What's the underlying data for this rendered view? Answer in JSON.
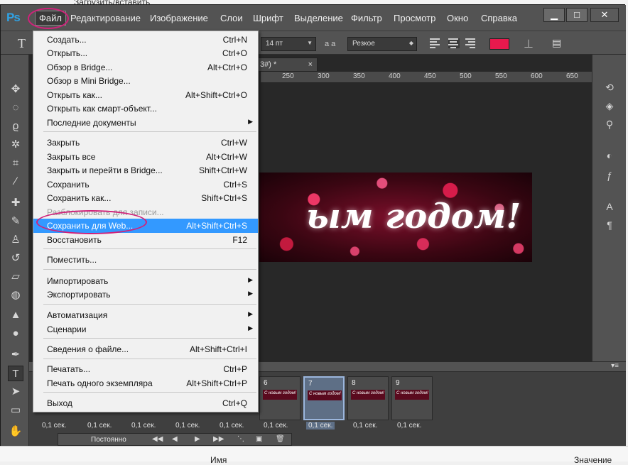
{
  "outer": {
    "top_text": "Загрузить/вставить",
    "bottom_name": "Имя",
    "bottom_value": "Значение"
  },
  "app": {
    "logo": "Ps",
    "menu": [
      "Файл",
      "Редактирование",
      "Изображение",
      "Слои",
      "Шрифт",
      "Выделение",
      "Фильтр",
      "Просмотр",
      "Окно",
      "Справка"
    ],
    "window_buttons": [
      "▁",
      "□",
      "✕"
    ]
  },
  "options": {
    "tool_letter": "T",
    "font_size": "14 пт",
    "aa_label": "a a",
    "antialias": "Резкое",
    "text_color": "#e8194d"
  },
  "document": {
    "tab": "3#) *",
    "ruler_ticks": [
      "250",
      "300",
      "350",
      "400",
      "450",
      "500",
      "550",
      "600",
      "650"
    ],
    "banner_text": "ым годом!"
  },
  "file_menu": {
    "items": [
      {
        "label": "Создать...",
        "shortcut": "Ctrl+N"
      },
      {
        "label": "Открыть...",
        "shortcut": "Ctrl+O"
      },
      {
        "label": "Обзор в Bridge...",
        "shortcut": "Alt+Ctrl+O"
      },
      {
        "label": "Обзор в Mini Bridge...",
        "shortcut": ""
      },
      {
        "label": "Открыть как...",
        "shortcut": "Alt+Shift+Ctrl+O"
      },
      {
        "label": "Открыть как смарт-объект...",
        "shortcut": ""
      },
      {
        "label": "Последние документы",
        "shortcut": "",
        "submenu": true
      },
      {
        "label": "Закрыть",
        "shortcut": "Ctrl+W"
      },
      {
        "label": "Закрыть все",
        "shortcut": "Alt+Ctrl+W"
      },
      {
        "label": "Закрыть и перейти в Bridge...",
        "shortcut": "Shift+Ctrl+W"
      },
      {
        "label": "Сохранить",
        "shortcut": "Ctrl+S"
      },
      {
        "label": "Сохранить как...",
        "shortcut": "Shift+Ctrl+S"
      },
      {
        "label": "Разблокировать для записи...",
        "shortcut": "",
        "disabled": true
      },
      {
        "label": "Сохранить для Web...",
        "shortcut": "Alt+Shift+Ctrl+S",
        "highlighted": true
      },
      {
        "label": "Восстановить",
        "shortcut": "F12"
      },
      {
        "label": "Поместить...",
        "shortcut": ""
      },
      {
        "label": "Импортировать",
        "shortcut": "",
        "submenu": true
      },
      {
        "label": "Экспортировать",
        "shortcut": "",
        "submenu": true
      },
      {
        "label": "Автоматизация",
        "shortcut": "",
        "submenu": true
      },
      {
        "label": "Сценарии",
        "shortcut": "",
        "submenu": true
      },
      {
        "label": "Сведения о файле...",
        "shortcut": "Alt+Shift+Ctrl+I"
      },
      {
        "label": "Печатать...",
        "shortcut": "Ctrl+P"
      },
      {
        "label": "Печать одного экземпляра",
        "shortcut": "Alt+Shift+Ctrl+P"
      },
      {
        "label": "Выход",
        "shortcut": "Ctrl+Q"
      }
    ]
  },
  "timeline": {
    "frames": [
      {
        "num": "6",
        "thumb": "С новым годом!",
        "delay": "0,1 сек."
      },
      {
        "num": "7",
        "thumb": "С новым годом!",
        "delay": "0,1 сек.",
        "selected": true
      },
      {
        "num": "8",
        "thumb": "С новым годом!",
        "delay": "0,1 сек."
      },
      {
        "num": "9",
        "thumb": "С новым годом!",
        "delay": "0,1 сек."
      }
    ],
    "hidden_delays": [
      "0,1 сек.",
      "0,1 сек.",
      "0,1 сек.",
      "0,1 сек.",
      "0,1 сек."
    ],
    "loop": "Постоянно"
  },
  "colors": {
    "accent_highlight": "#3399ff",
    "annotation": "#d0217a"
  }
}
